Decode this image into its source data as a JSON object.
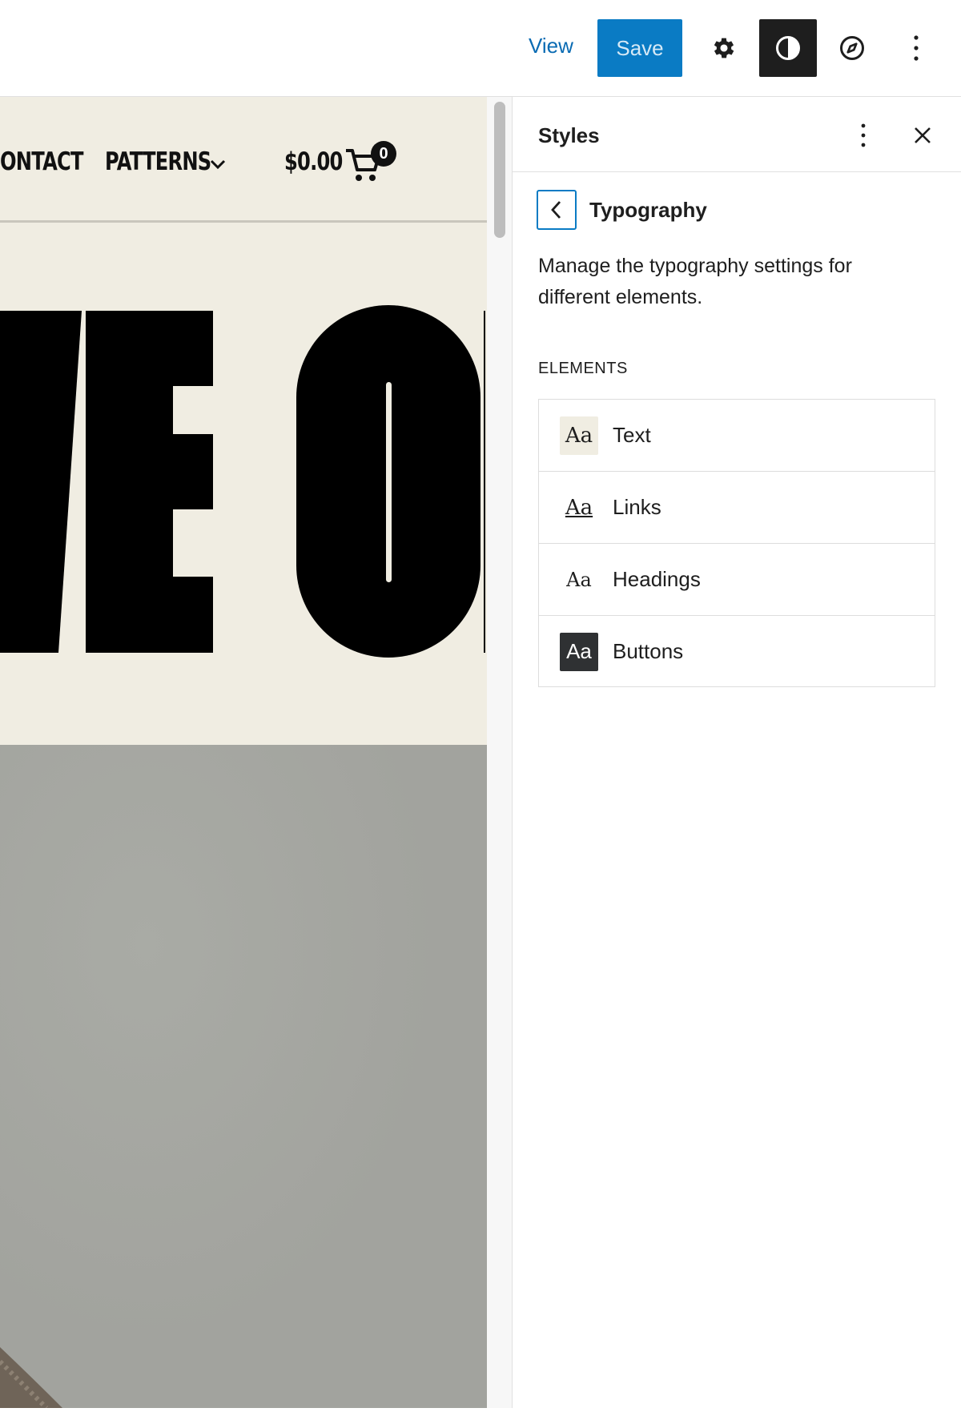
{
  "toolbar": {
    "view_label": "View",
    "save_label": "Save",
    "icons": [
      "gear-icon",
      "contrast-icon",
      "compass-icon",
      "more-vertical-icon"
    ]
  },
  "canvas": {
    "nav": {
      "contact": "ONTACT",
      "patterns": "PATTERNS",
      "cart_total": "$0.00",
      "cart_count": "0"
    },
    "hero_text_visible": "VE O",
    "colors": {
      "background": "#f0ede2",
      "ink": "#000000",
      "photo": "#a7a8a3"
    }
  },
  "sidebar": {
    "title": "Styles",
    "section_title": "Typography",
    "description": "Manage the typography settings for different elements.",
    "elements_heading": "ELEMENTS",
    "elements": [
      {
        "swatch": "Aa",
        "label": "Text",
        "swatch_style": "highlight"
      },
      {
        "swatch": "Aa",
        "label": "Links",
        "swatch_style": "underline"
      },
      {
        "swatch": "Aa",
        "label": "Headings",
        "swatch_style": "plain"
      },
      {
        "swatch": "Aa",
        "label": "Buttons",
        "swatch_style": "dark"
      }
    ]
  },
  "colors": {
    "accent": "#0a7bc4",
    "save_button_text": "#d6e9f6",
    "dark": "#1e1e1e"
  }
}
